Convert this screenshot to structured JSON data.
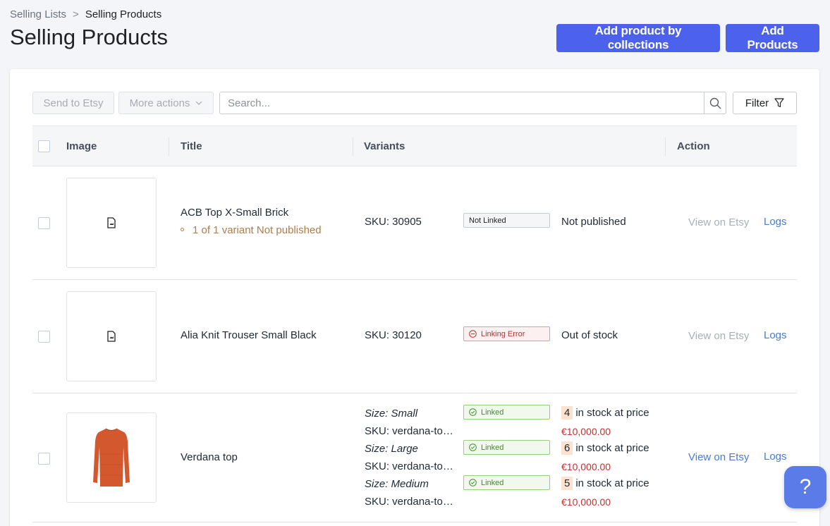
{
  "breadcrumb": {
    "parent": "Selling Lists",
    "separator": ">",
    "current": "Selling Products"
  },
  "page": {
    "title": "Selling Products"
  },
  "header_actions": {
    "add_by_collections": "Add product by collections",
    "add_products": "Add Products"
  },
  "toolbar": {
    "send_to_etsy": "Send to Etsy",
    "more_actions": "More actions",
    "search_placeholder": "Search...",
    "filter": "Filter"
  },
  "table": {
    "headers": {
      "image": "Image",
      "title": "Title",
      "variants": "Variants",
      "action": "Action"
    },
    "rows": [
      {
        "title": "ACB Top X-Small Brick",
        "subtitle": "1 of 1 variant Not published",
        "sku": "SKU: 30905",
        "status": "Not Linked",
        "stock": "Not published",
        "view": "View on Etsy",
        "logs": "Logs"
      },
      {
        "title": "Alia Knit Trouser Small Black",
        "sku": "SKU: 30120",
        "status": "Linking Error",
        "stock": "Out of stock",
        "view": "View on Etsy",
        "logs": "Logs"
      },
      {
        "title": "Verdana top",
        "view": "View on Etsy",
        "logs": "Logs",
        "variants": [
          {
            "size": "Size: Small",
            "sku": "SKU: verdana-to…",
            "status": "Linked",
            "qty": "4",
            "stock_text": "in stock at price",
            "price": "€10,000.00"
          },
          {
            "size": "Size: Large",
            "sku": "SKU: verdana-to…",
            "status": "Linked",
            "qty": "6",
            "stock_text": "in stock at price",
            "price": "€10,000.00"
          },
          {
            "size": "Size: Medium",
            "sku": "SKU: verdana-to…",
            "status": "Linked",
            "qty": "5",
            "stock_text": "in stock at price",
            "price": "€10,000.00"
          }
        ]
      }
    ]
  },
  "help": {
    "label": "?"
  },
  "colors": {
    "primary": "#4c62ec",
    "link": "#4a7ad4",
    "price": "#c4312f",
    "linked": "#3f8c2a",
    "error": "#bf2d2d",
    "warning_text": "#b17c4a"
  }
}
